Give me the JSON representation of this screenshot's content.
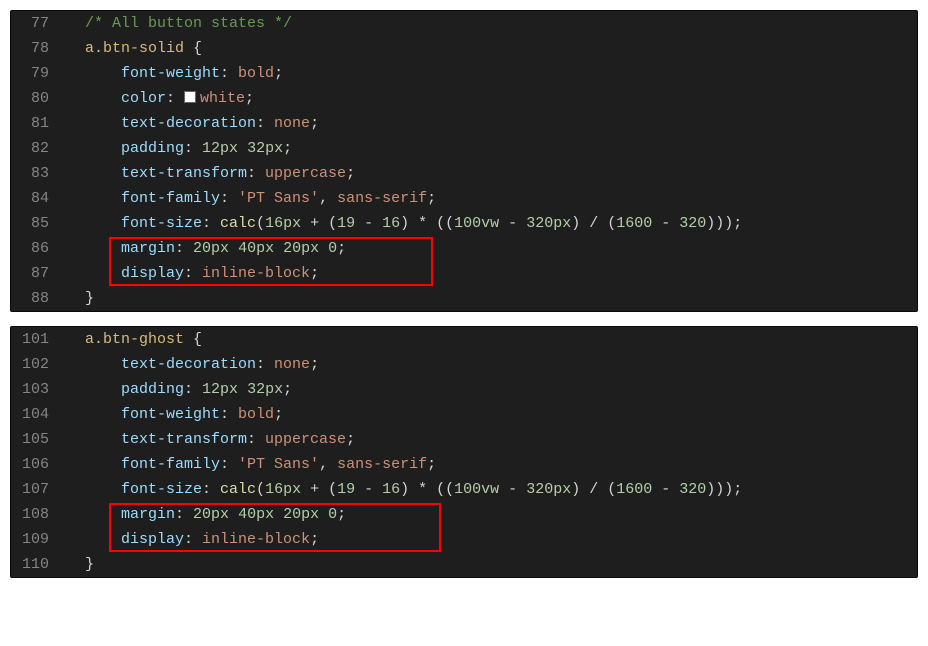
{
  "blocks": [
    {
      "highlight": {
        "topLine": 9,
        "bottomLine": 10,
        "leftPx": 98,
        "rightPx": 422
      },
      "lines": [
        {
          "num": "77",
          "indent": 1,
          "tokens": [
            {
              "cls": "tok-comment",
              "txt": "/* All button states */"
            }
          ]
        },
        {
          "num": "78",
          "indent": 1,
          "tokens": [
            {
              "cls": "tok-selector",
              "txt": "a.btn-solid"
            },
            {
              "cls": "tok-brace",
              "txt": " {"
            }
          ]
        },
        {
          "num": "79",
          "indent": 2,
          "tokens": [
            {
              "cls": "tok-prop",
              "txt": "font-weight"
            },
            {
              "cls": "tok-punc",
              "txt": ": "
            },
            {
              "cls": "tok-ident",
              "txt": "bold"
            },
            {
              "cls": "tok-punc",
              "txt": ";"
            }
          ]
        },
        {
          "num": "80",
          "indent": 2,
          "tokens": [
            {
              "cls": "tok-prop",
              "txt": "color"
            },
            {
              "cls": "tok-punc",
              "txt": ": "
            },
            {
              "swatch": true
            },
            {
              "cls": "tok-ident",
              "txt": "white"
            },
            {
              "cls": "tok-punc",
              "txt": ";"
            }
          ]
        },
        {
          "num": "81",
          "indent": 2,
          "tokens": [
            {
              "cls": "tok-prop",
              "txt": "text-decoration"
            },
            {
              "cls": "tok-punc",
              "txt": ": "
            },
            {
              "cls": "tok-ident",
              "txt": "none"
            },
            {
              "cls": "tok-punc",
              "txt": ";"
            }
          ]
        },
        {
          "num": "82",
          "indent": 2,
          "tokens": [
            {
              "cls": "tok-prop",
              "txt": "padding"
            },
            {
              "cls": "tok-punc",
              "txt": ": "
            },
            {
              "cls": "tok-num",
              "txt": "12px"
            },
            {
              "cls": "tok-punc",
              "txt": " "
            },
            {
              "cls": "tok-num",
              "txt": "32px"
            },
            {
              "cls": "tok-punc",
              "txt": ";"
            }
          ]
        },
        {
          "num": "83",
          "indent": 2,
          "tokens": [
            {
              "cls": "tok-prop",
              "txt": "text-transform"
            },
            {
              "cls": "tok-punc",
              "txt": ": "
            },
            {
              "cls": "tok-ident",
              "txt": "uppercase"
            },
            {
              "cls": "tok-punc",
              "txt": ";"
            }
          ]
        },
        {
          "num": "84",
          "indent": 2,
          "tokens": [
            {
              "cls": "tok-prop",
              "txt": "font-family"
            },
            {
              "cls": "tok-punc",
              "txt": ": "
            },
            {
              "cls": "tok-str",
              "txt": "'PT Sans'"
            },
            {
              "cls": "tok-punc",
              "txt": ", "
            },
            {
              "cls": "tok-ident",
              "txt": "sans-serif"
            },
            {
              "cls": "tok-punc",
              "txt": ";"
            }
          ]
        },
        {
          "num": "85",
          "indent": 2,
          "tokens": [
            {
              "cls": "tok-prop",
              "txt": "font-size"
            },
            {
              "cls": "tok-punc",
              "txt": ": "
            },
            {
              "cls": "tok-func",
              "txt": "calc"
            },
            {
              "cls": "tok-punc",
              "txt": "("
            },
            {
              "cls": "tok-num",
              "txt": "16px"
            },
            {
              "cls": "tok-punc",
              "txt": " + ("
            },
            {
              "cls": "tok-num",
              "txt": "19"
            },
            {
              "cls": "tok-punc",
              "txt": " - "
            },
            {
              "cls": "tok-num",
              "txt": "16"
            },
            {
              "cls": "tok-punc",
              "txt": ") * (("
            },
            {
              "cls": "tok-num",
              "txt": "100vw"
            },
            {
              "cls": "tok-punc",
              "txt": " - "
            },
            {
              "cls": "tok-num",
              "txt": "320px"
            },
            {
              "cls": "tok-punc",
              "txt": ") / ("
            },
            {
              "cls": "tok-num",
              "txt": "1600"
            },
            {
              "cls": "tok-punc",
              "txt": " - "
            },
            {
              "cls": "tok-num",
              "txt": "320"
            },
            {
              "cls": "tok-punc",
              "txt": ")));"
            }
          ]
        },
        {
          "num": "86",
          "indent": 2,
          "tokens": [
            {
              "cls": "tok-prop",
              "txt": "margin"
            },
            {
              "cls": "tok-punc",
              "txt": ": "
            },
            {
              "cls": "tok-num",
              "txt": "20px"
            },
            {
              "cls": "tok-punc",
              "txt": " "
            },
            {
              "cls": "tok-num",
              "txt": "40px"
            },
            {
              "cls": "tok-punc",
              "txt": " "
            },
            {
              "cls": "tok-num",
              "txt": "20px"
            },
            {
              "cls": "tok-punc",
              "txt": " "
            },
            {
              "cls": "tok-num",
              "txt": "0"
            },
            {
              "cls": "tok-punc",
              "txt": ";"
            }
          ]
        },
        {
          "num": "87",
          "indent": 2,
          "tokens": [
            {
              "cls": "tok-prop",
              "txt": "display"
            },
            {
              "cls": "tok-punc",
              "txt": ": "
            },
            {
              "cls": "tok-ident",
              "txt": "inline-block"
            },
            {
              "cls": "tok-punc",
              "txt": ";"
            }
          ]
        },
        {
          "num": "88",
          "indent": 1,
          "tokens": [
            {
              "cls": "tok-brace",
              "txt": "}"
            }
          ]
        }
      ]
    },
    {
      "highlight": {
        "topLine": 7,
        "bottomLine": 8,
        "leftPx": 98,
        "rightPx": 430
      },
      "lines": [
        {
          "num": "101",
          "indent": 1,
          "tokens": [
            {
              "cls": "tok-selector",
              "txt": "a.btn-ghost"
            },
            {
              "cls": "tok-brace",
              "txt": " {"
            }
          ]
        },
        {
          "num": "102",
          "indent": 2,
          "tokens": [
            {
              "cls": "tok-prop",
              "txt": "text-decoration"
            },
            {
              "cls": "tok-punc",
              "txt": ": "
            },
            {
              "cls": "tok-ident",
              "txt": "none"
            },
            {
              "cls": "tok-punc",
              "txt": ";"
            }
          ]
        },
        {
          "num": "103",
          "indent": 2,
          "tokens": [
            {
              "cls": "tok-prop",
              "txt": "padding"
            },
            {
              "cls": "tok-punc",
              "txt": ": "
            },
            {
              "cls": "tok-num",
              "txt": "12px"
            },
            {
              "cls": "tok-punc",
              "txt": " "
            },
            {
              "cls": "tok-num",
              "txt": "32px"
            },
            {
              "cls": "tok-punc",
              "txt": ";"
            }
          ]
        },
        {
          "num": "104",
          "indent": 2,
          "tokens": [
            {
              "cls": "tok-prop",
              "txt": "font-weight"
            },
            {
              "cls": "tok-punc",
              "txt": ": "
            },
            {
              "cls": "tok-ident",
              "txt": "bold"
            },
            {
              "cls": "tok-punc",
              "txt": ";"
            }
          ]
        },
        {
          "num": "105",
          "indent": 2,
          "tokens": [
            {
              "cls": "tok-prop",
              "txt": "text-transform"
            },
            {
              "cls": "tok-punc",
              "txt": ": "
            },
            {
              "cls": "tok-ident",
              "txt": "uppercase"
            },
            {
              "cls": "tok-punc",
              "txt": ";"
            }
          ]
        },
        {
          "num": "106",
          "indent": 2,
          "tokens": [
            {
              "cls": "tok-prop",
              "txt": "font-family"
            },
            {
              "cls": "tok-punc",
              "txt": ": "
            },
            {
              "cls": "tok-str",
              "txt": "'PT Sans'"
            },
            {
              "cls": "tok-punc",
              "txt": ", "
            },
            {
              "cls": "tok-ident",
              "txt": "sans-serif"
            },
            {
              "cls": "tok-punc",
              "txt": ";"
            }
          ]
        },
        {
          "num": "107",
          "indent": 2,
          "tokens": [
            {
              "cls": "tok-prop",
              "txt": "font-size"
            },
            {
              "cls": "tok-punc",
              "txt": ": "
            },
            {
              "cls": "tok-func",
              "txt": "calc"
            },
            {
              "cls": "tok-punc",
              "txt": "("
            },
            {
              "cls": "tok-num",
              "txt": "16px"
            },
            {
              "cls": "tok-punc",
              "txt": " + ("
            },
            {
              "cls": "tok-num",
              "txt": "19"
            },
            {
              "cls": "tok-punc",
              "txt": " - "
            },
            {
              "cls": "tok-num",
              "txt": "16"
            },
            {
              "cls": "tok-punc",
              "txt": ") * (("
            },
            {
              "cls": "tok-num",
              "txt": "100vw"
            },
            {
              "cls": "tok-punc",
              "txt": " - "
            },
            {
              "cls": "tok-num",
              "txt": "320px"
            },
            {
              "cls": "tok-punc",
              "txt": ") / ("
            },
            {
              "cls": "tok-num",
              "txt": "1600"
            },
            {
              "cls": "tok-punc",
              "txt": " - "
            },
            {
              "cls": "tok-num",
              "txt": "320"
            },
            {
              "cls": "tok-punc",
              "txt": ")));"
            }
          ]
        },
        {
          "num": "108",
          "indent": 2,
          "tokens": [
            {
              "cls": "tok-prop",
              "txt": "margin"
            },
            {
              "cls": "tok-punc",
              "txt": ": "
            },
            {
              "cls": "tok-num",
              "txt": "20px"
            },
            {
              "cls": "tok-punc",
              "txt": " "
            },
            {
              "cls": "tok-num",
              "txt": "40px"
            },
            {
              "cls": "tok-punc",
              "txt": " "
            },
            {
              "cls": "tok-num",
              "txt": "20px"
            },
            {
              "cls": "tok-punc",
              "txt": " "
            },
            {
              "cls": "tok-num",
              "txt": "0"
            },
            {
              "cls": "tok-punc",
              "txt": ";"
            }
          ]
        },
        {
          "num": "109",
          "indent": 2,
          "tokens": [
            {
              "cls": "tok-prop",
              "txt": "display"
            },
            {
              "cls": "tok-punc",
              "txt": ": "
            },
            {
              "cls": "tok-ident",
              "txt": "inline-block"
            },
            {
              "cls": "tok-punc",
              "txt": ";"
            }
          ]
        },
        {
          "num": "110",
          "indent": 1,
          "tokens": [
            {
              "cls": "tok-brace",
              "txt": "}"
            }
          ]
        }
      ]
    }
  ]
}
